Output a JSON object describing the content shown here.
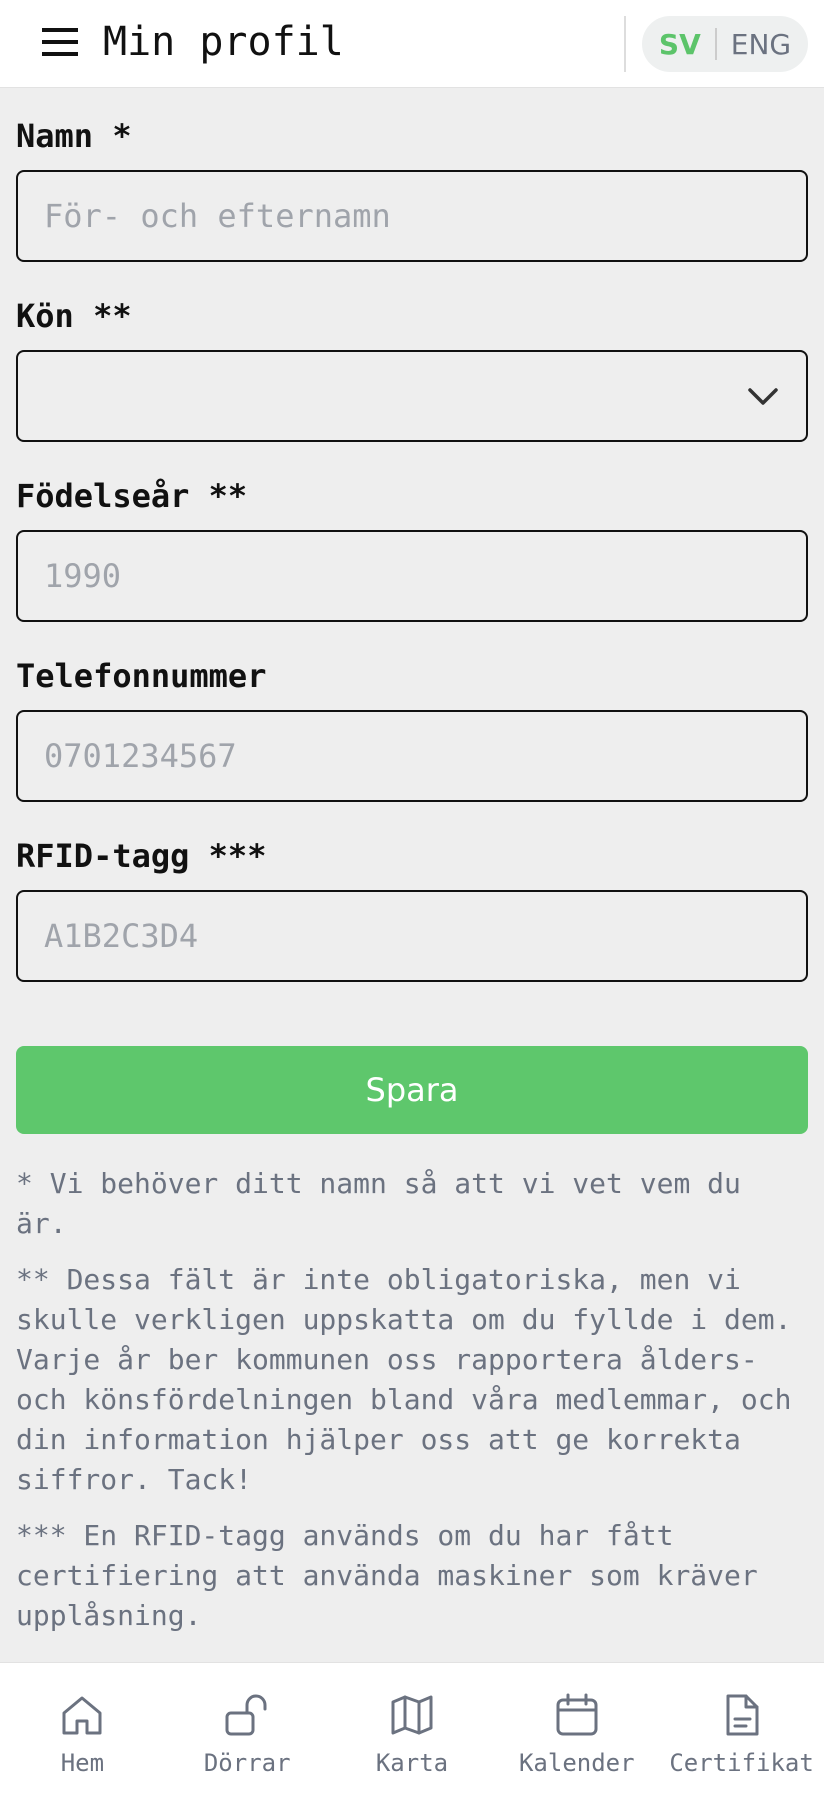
{
  "header": {
    "title": "Min profil",
    "lang": {
      "sv": "SV",
      "en": "ENG",
      "active": "SV",
      "active_color": "#5cc46a"
    }
  },
  "form": {
    "name": {
      "label": "Namn *",
      "placeholder": "För- och efternamn",
      "value": ""
    },
    "gender": {
      "label": "Kön **",
      "value": ""
    },
    "birth_year": {
      "label": "Födelseår **",
      "placeholder": "1990",
      "value": ""
    },
    "phone": {
      "label": "Telefonnummer",
      "placeholder": "0701234567",
      "value": ""
    },
    "rfid": {
      "label": "RFID-tagg ***",
      "placeholder": "A1B2C3D4",
      "value": ""
    },
    "save_label": "Spara",
    "save_color": "#5ec76c"
  },
  "notes": {
    "n1": "* Vi behöver ditt namn så att vi vet vem du är.",
    "n2": "** Dessa fält är inte obligatoriska, men vi skulle verkligen uppskatta om du fyllde i dem. Varje år ber kommunen oss rapportera ålders- och könsfördelningen bland våra medlemmar, och din information hjälper oss att ge korrekta siffror. Tack!",
    "n3": "*** En RFID-tagg används om du har fått certifiering att använda maskiner som kräver upplåsning."
  },
  "nav": {
    "items": [
      {
        "label": "Hem",
        "icon": "home-icon"
      },
      {
        "label": "Dörrar",
        "icon": "unlock-icon"
      },
      {
        "label": "Karta",
        "icon": "map-icon"
      },
      {
        "label": "Kalender",
        "icon": "calendar-icon"
      },
      {
        "label": "Certifikat",
        "icon": "document-icon"
      }
    ]
  }
}
